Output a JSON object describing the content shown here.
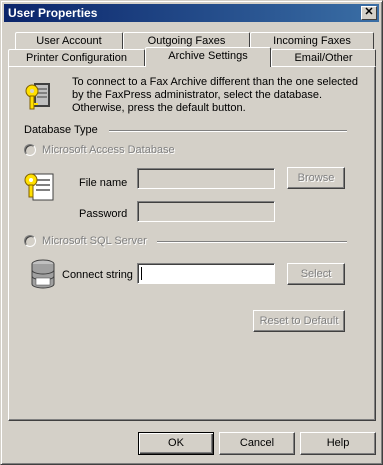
{
  "window": {
    "title": "User Properties",
    "close_glyph": "✕"
  },
  "tabs": {
    "row_back": [
      "User Account",
      "Outgoing Faxes",
      "Incoming Faxes"
    ],
    "row_front": [
      "Printer Configuration",
      "Archive Settings",
      "Email/Other"
    ],
    "active": "Archive Settings"
  },
  "archive": {
    "info": "To connect to a Fax Archive different than the one selected by the FaxPress administrator, select the database. Otherwise, press the default button.",
    "database_type_label": "Database Type",
    "access_label": "Microsoft Access Database",
    "file_name_label": "File name",
    "file_name_value": "",
    "browse_label": "Browse",
    "password_label": "Password",
    "password_value": "",
    "sql_label": "Microsoft SQL Server",
    "connect_string_label": "Connect string",
    "connect_string_value": "",
    "select_label": "Select",
    "reset_label": "Reset to Default"
  },
  "footer": {
    "ok": "OK",
    "cancel": "Cancel",
    "help": "Help"
  },
  "icons": {
    "archive": "archive-key-icon",
    "access": "access-database-icon",
    "sql": "sql-server-icon"
  },
  "colors": {
    "titlebar_start": "#0a246a",
    "titlebar_end": "#3a6ea5",
    "face": "#d4d0c8"
  }
}
